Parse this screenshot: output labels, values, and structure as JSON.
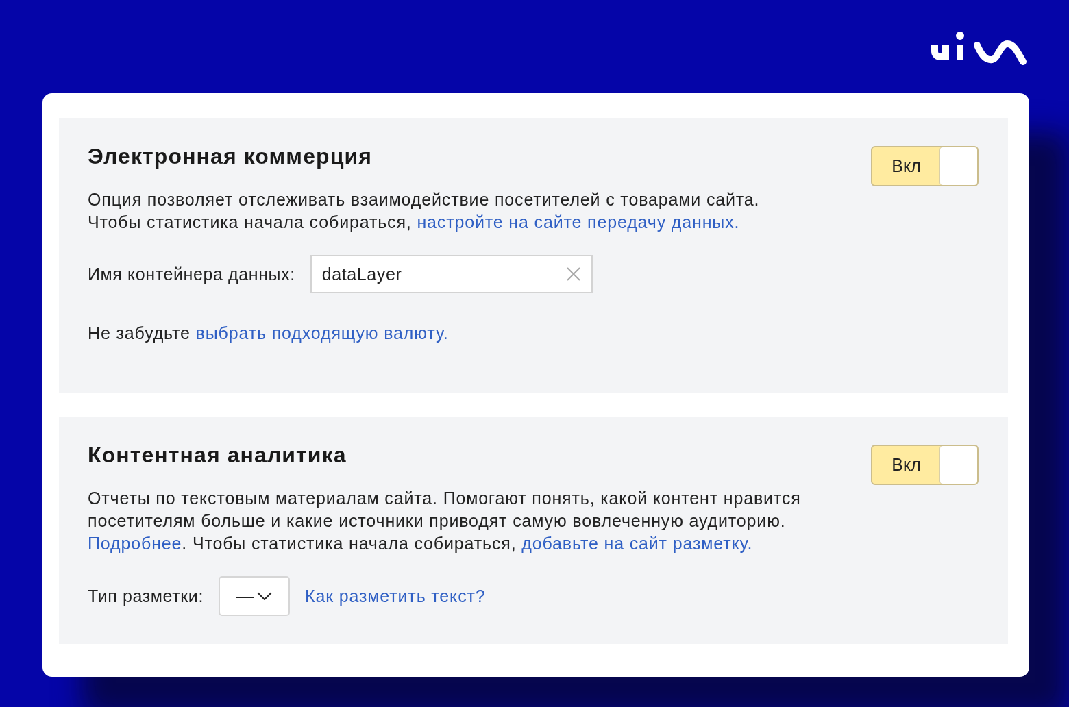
{
  "sections": [
    {
      "title": "Электронная коммерция",
      "toggle": {
        "label": "Вкл",
        "on": true
      },
      "description": [
        [
          {
            "kind": "text",
            "text": "Опция позволяет отслеживать взаимодействие посетителей с товарами сайта."
          }
        ],
        [
          {
            "kind": "text",
            "text": "Чтобы статистика начала собираться, "
          },
          {
            "kind": "link",
            "text": "настройте на сайте передачу данных."
          }
        ]
      ],
      "rows": [
        {
          "kind": "input",
          "label": "Имя контейнера данных:",
          "value": "dataLayer"
        },
        {
          "kind": "note",
          "segments": [
            {
              "kind": "text",
              "text": "Не забудьте "
            },
            {
              "kind": "link",
              "text": "выбрать подходящую валюту."
            }
          ]
        }
      ]
    },
    {
      "title": "Контентная аналитика",
      "toggle": {
        "label": "Вкл",
        "on": true
      },
      "description": [
        [
          {
            "kind": "text",
            "text": "Отчеты по текстовым материалам сайта. Помогают понять, какой контент нравится"
          }
        ],
        [
          {
            "kind": "text",
            "text": "посетителям больше и какие источники приводят самую вовлеченную аудиторию."
          }
        ],
        [
          {
            "kind": "link",
            "text": "Подробнее"
          },
          {
            "kind": "text",
            "text": ". Чтобы статистика начала собираться, "
          },
          {
            "kind": "link",
            "text": "добавьте на сайт разметку."
          }
        ]
      ],
      "rows": [
        {
          "kind": "select",
          "label": "Тип разметки:",
          "value": "—",
          "help_link": "Как разметить текст?"
        }
      ]
    }
  ]
}
